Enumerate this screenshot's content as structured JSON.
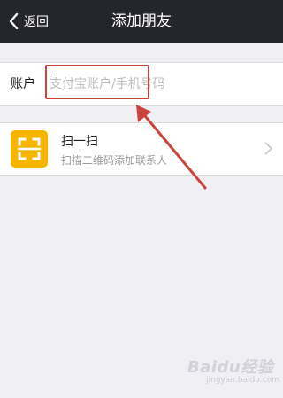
{
  "navbar": {
    "back_label": "返回",
    "title": "添加朋友"
  },
  "account": {
    "label": "账户",
    "placeholder": "支付宝账户/手机号码",
    "value": ""
  },
  "scan": {
    "title": "扫一扫",
    "subtitle": "扫描二维码添加联系人",
    "icon": "scan-icon"
  },
  "annotation": {
    "color": "#c9443c"
  },
  "watermark": {
    "text": "Baidu经验",
    "sub": "jingyan.baidu.com"
  },
  "colors": {
    "navbar": "#25262b",
    "background": "#efeff4",
    "scan_icon_bg": "#f7b500"
  }
}
